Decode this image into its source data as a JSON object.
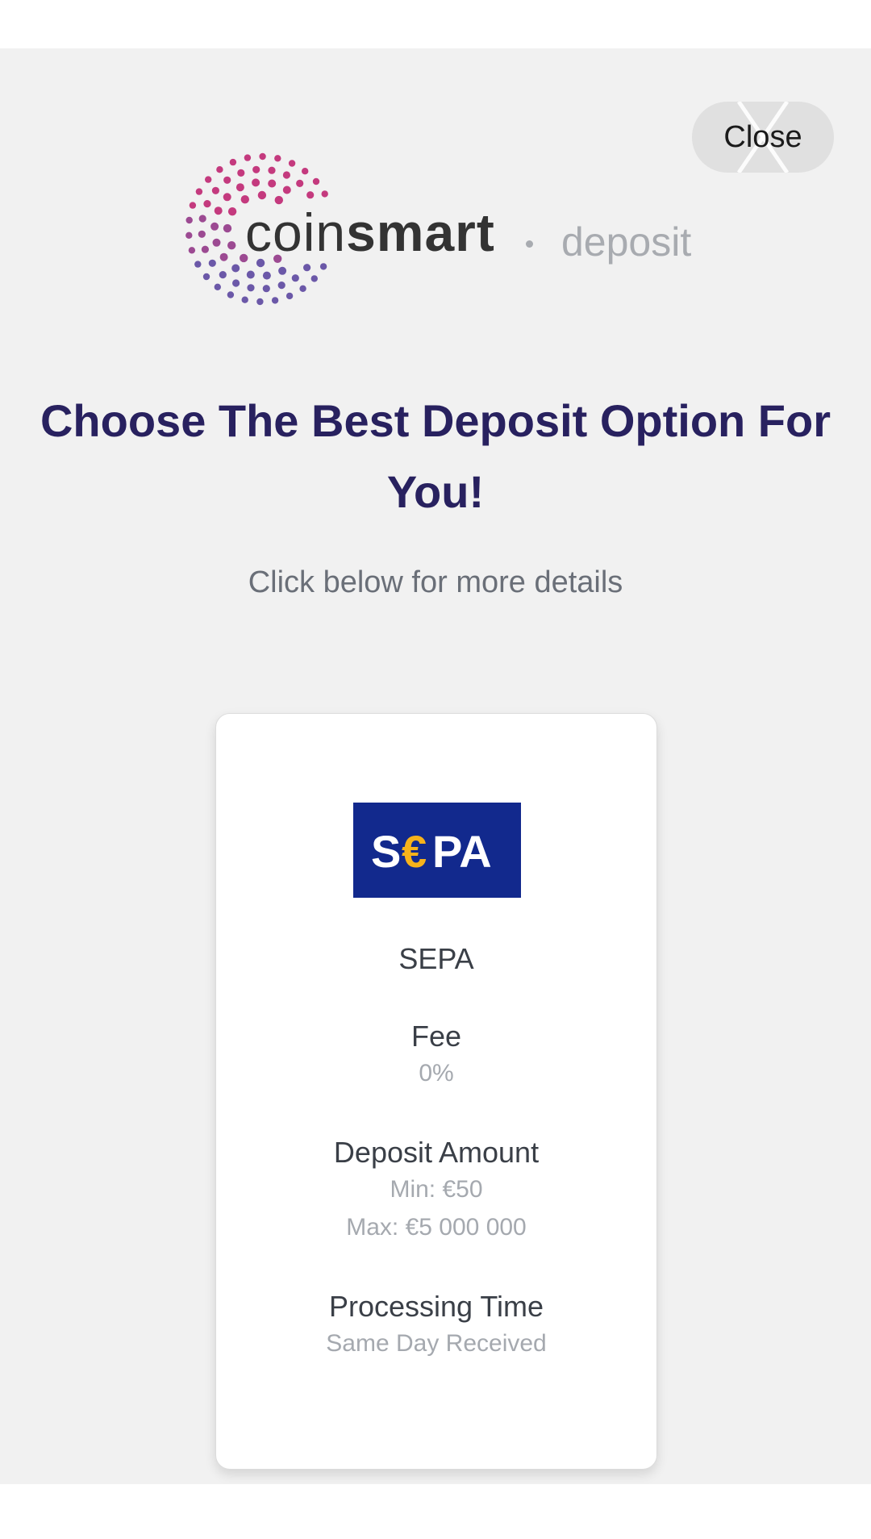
{
  "modal": {
    "close_label": "Close"
  },
  "brand": {
    "name_light": "coin",
    "name_bold": "smart",
    "section": "deposit",
    "dot_colors": [
      "#c43a7e",
      "#9c4a92",
      "#6b58a8"
    ]
  },
  "headline": "Choose The Best Deposit Option For You!",
  "subhead": "Click below for more details",
  "deposit_option": {
    "logo_text_s": "S",
    "logo_text_euro": "€",
    "logo_text_pa": "PA",
    "logo_bg_color": "#12298d",
    "logo_euro_color": "#f7b21b",
    "method_name": "SEPA",
    "fee_label": "Fee",
    "fee_value": "0%",
    "amount_label": "Deposit Amount",
    "amount_min": "Min: €50",
    "amount_max": "Max: €5 000 000",
    "time_label": "Processing Time",
    "time_value": "Same Day Received"
  },
  "colors": {
    "headline": "#28215f",
    "modal_bg": "#f1f1f1"
  }
}
